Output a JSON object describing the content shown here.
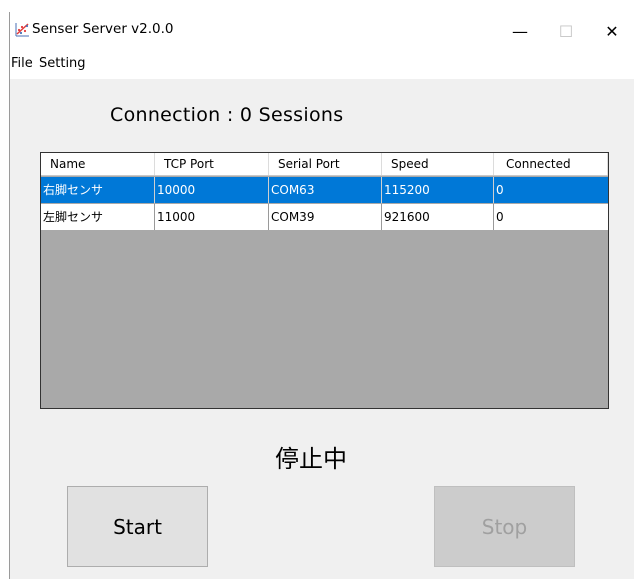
{
  "window": {
    "title": "Senser Server v2.0.0",
    "minimize_glyph": "—",
    "maximize_glyph": "☐",
    "close_glyph": "✕"
  },
  "menu": {
    "items": [
      "File",
      "Setting"
    ]
  },
  "connection": {
    "label": "Connection :   0 Sessions"
  },
  "table": {
    "columns": [
      "Name",
      "TCP Port",
      "Serial Port",
      "Speed",
      "Connected"
    ],
    "rows": [
      {
        "name": "右脚センサ",
        "tcp_port": "10000",
        "serial_port": "COM63",
        "speed": "115200",
        "connected": "0",
        "selected": true
      },
      {
        "name": "左脚センサ",
        "tcp_port": "11000",
        "serial_port": "COM39",
        "speed": "921600",
        "connected": "0",
        "selected": false
      }
    ]
  },
  "status": {
    "text": "停止中"
  },
  "buttons": {
    "start_label": "Start",
    "stop_label": "Stop",
    "stop_enabled": false
  },
  "colors": {
    "selection": "#0078d7",
    "list_background": "#a9a9a9",
    "window_background": "#f0f0f0"
  },
  "icons": {
    "app": "scatter-graph-icon"
  }
}
